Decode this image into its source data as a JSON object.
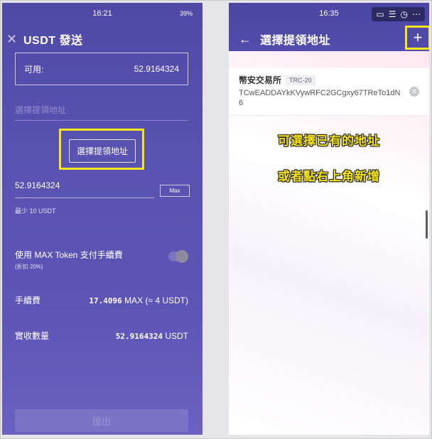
{
  "left": {
    "status_time": "16:21",
    "status_battery": "39%",
    "title": "USDT 發送",
    "close_icon": "close-icon",
    "available_label": "可用:",
    "available_value": "52.9164324",
    "address_placeholder": "選擇提領地址",
    "select_address_button": "選擇提領地址",
    "amount_value": "52.9164324",
    "max_label": "Max",
    "min_label": "最少 10 USDT",
    "fee_toggle_label": "使用 MAX Token 支付手續費",
    "fee_toggle_sub": "(折扣 20%)",
    "fee_label": "手續費",
    "fee_value_num": "17.4096",
    "fee_value_unit": "MAX (≈ 4 USDT)",
    "receive_label": "實收數量",
    "receive_value_num": "52.9164324",
    "receive_value_unit": "USDT",
    "withdraw_button": "提出"
  },
  "right": {
    "status_time": "16:35",
    "title": "選擇提領地址",
    "back_icon": "back-arrow-icon",
    "add_icon": "plus-icon",
    "address_item": {
      "name": "幣安交易所",
      "network": "TRC-20",
      "address": "TCwEADDAYkKVywRFC2GCgxy67TReTo1dN6"
    },
    "note_line1": "可選擇已有的地址",
    "note_line2": "或者點右上角新增"
  },
  "colors": {
    "left_bg": "#5852b1",
    "highlight": "#f5e61a",
    "right_header": "#4b46a3"
  }
}
